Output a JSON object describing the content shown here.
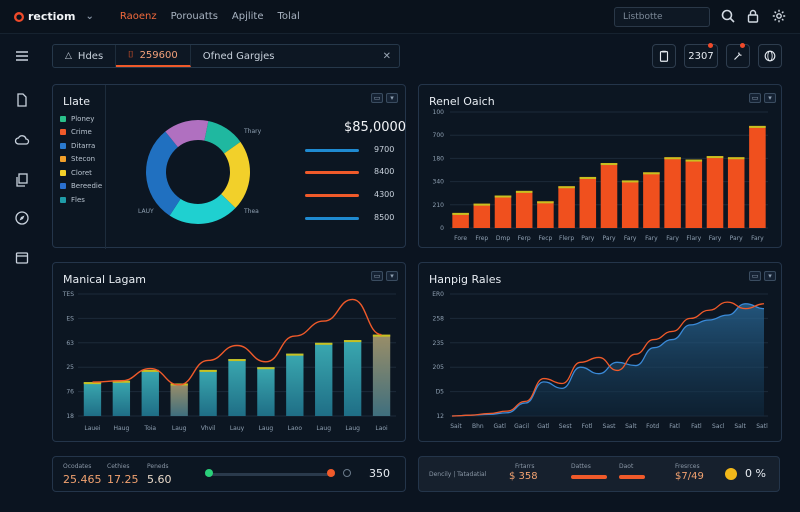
{
  "app": {
    "brand": "rectiom",
    "nav": [
      "Raoenz",
      "Porouatts",
      "Apjlite",
      "Tolal"
    ],
    "active_nav": 0,
    "search_placeholder": "Listbotte"
  },
  "tabs": {
    "items": [
      "Hdes",
      "259600",
      "Ofned Gargjes"
    ],
    "active": 1
  },
  "header": {
    "counter": "2307"
  },
  "colors": {
    "accent": "#f05a2a",
    "teal": "#1fc8c0",
    "blue": "#2a7ad0",
    "yellow": "#f2d02a",
    "purple": "#b070c0",
    "green": "#2ab080"
  },
  "panel_donut": {
    "title": "Llate",
    "legend": [
      "Ploney",
      "Crime",
      "Ditarra",
      "Stecon",
      "Cloret",
      "Bereedie",
      "Fles"
    ],
    "legend_colors": [
      "#2ac08a",
      "#f05a2a",
      "#2a7ad0",
      "#f2a02a",
      "#f2d02a",
      "#2a70d0",
      "#1f9ca8"
    ],
    "value": "$85,0000",
    "stats": [
      {
        "value": "9700",
        "color": "#1f8ad0"
      },
      {
        "value": "8400",
        "color": "#f05a2a"
      },
      {
        "value": "4300",
        "color": "#f05a2a"
      },
      {
        "value": "8500",
        "color": "#1f8ad0"
      }
    ],
    "labels": [
      "Thary",
      "LAUY",
      "Thea"
    ]
  },
  "panel_bar_top": {
    "title": "Renel Oaich"
  },
  "panel_bar_bottom": {
    "title": "Manical Lagam"
  },
  "panel_area": {
    "title": "Hanpig Rales"
  },
  "bottom_left": {
    "stats": [
      {
        "label": "Ocodates",
        "value": "25.465"
      },
      {
        "label": "Cethies",
        "value": "17.25"
      },
      {
        "label": "Peneds",
        "value": "5.60"
      }
    ],
    "end_value": "350"
  },
  "bottom_right": {
    "stats": [
      {
        "label": "Dencily | Tatadatial",
        "value": ""
      },
      {
        "label": "Frtarrs",
        "value": "$ 358"
      },
      {
        "label": "Dattes",
        "value": ""
      },
      {
        "label": "Daot",
        "value": ""
      },
      {
        "label": "Fresrces",
        "value": "$7/49"
      }
    ],
    "toggle_value": "0 %"
  },
  "chart_data": [
    {
      "type": "pie",
      "title": "Llate",
      "categories": [
        "Teal",
        "Yellow",
        "Cyan",
        "Blue",
        "Purple"
      ],
      "values": [
        12,
        22,
        22,
        30,
        14
      ],
      "colors": [
        "#1fb8a0",
        "#f2d02a",
        "#1fd0d0",
        "#2070c0",
        "#b070c0"
      ]
    },
    {
      "type": "bar",
      "title": "Renel Oaich",
      "categories": [
        "Fore",
        "Frep",
        "Dmp",
        "Ferp",
        "Fecp",
        "Flerp",
        "Pary",
        "Pary",
        "Fary",
        "Fary",
        "Fary",
        "Flary",
        "Fary",
        "Pary",
        "Fary"
      ],
      "values": [
        130,
        210,
        280,
        320,
        230,
        360,
        440,
        560,
        410,
        480,
        610,
        590,
        620,
        610,
        880
      ],
      "yticks": [
        "0",
        "210",
        "340",
        "180",
        "700",
        "100"
      ],
      "ylim": [
        0,
        1000
      ]
    },
    {
      "type": "bar",
      "title": "Manical Lagam",
      "categories": [
        "Lauei",
        "Haug",
        "Toia",
        "Laug",
        "Vhvil",
        "Lauy",
        "Laug",
        "Laoo",
        "Laug",
        "Laug",
        "Laoi"
      ],
      "values": [
        250,
        260,
        340,
        240,
        340,
        420,
        360,
        460,
        540,
        560,
        600
      ],
      "line": [
        250,
        260,
        350,
        230,
        410,
        520,
        400,
        590,
        700,
        860,
        600
      ],
      "yticks": [
        "18",
        "76",
        "25",
        "63",
        "ES",
        "TES"
      ],
      "ylim": [
        0,
        900
      ]
    },
    {
      "type": "area",
      "title": "Hanpig Rales",
      "categories": [
        "Sait",
        "Bhn",
        "Gatl",
        "Gacil",
        "Gatl",
        "Sest",
        "Fotl",
        "Sast",
        "Salt",
        "Fotd",
        "Fatl",
        "Fatl",
        "Sacl",
        "Salt",
        "Satl"
      ],
      "series": [
        {
          "values": [
            0,
            5,
            10,
            20,
            80,
            210,
            170,
            300,
            260,
            330,
            310,
            420,
            470,
            560,
            590,
            620,
            690,
            660
          ]
        },
        {
          "values": [
            0,
            5,
            15,
            30,
            90,
            230,
            200,
            330,
            360,
            280,
            380,
            470,
            520,
            600,
            650,
            700,
            660,
            690
          ]
        }
      ],
      "yticks": [
        "12",
        "D5",
        "205",
        "235",
        "258",
        "ER0"
      ],
      "ylim": [
        0,
        750
      ]
    }
  ]
}
